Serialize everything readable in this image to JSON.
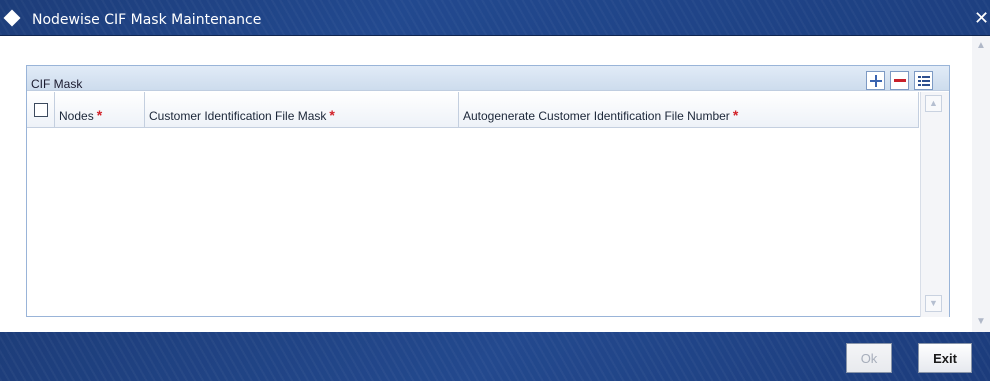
{
  "window": {
    "title": "Nodewise CIF Mask Maintenance",
    "close_glyph": "✕"
  },
  "panel": {
    "title": "CIF Mask",
    "toolbar": {
      "add_icon": "plus-icon",
      "delete_icon": "minus-icon",
      "select_icon": "list-icon"
    }
  },
  "grid": {
    "columns": [
      {
        "label": "Nodes",
        "required": true
      },
      {
        "label": "Customer Identification File Mask",
        "required": true
      },
      {
        "label": "Autogenerate Customer Identification File Number",
        "required": true
      }
    ],
    "required_marker": "*",
    "rows": []
  },
  "footer": {
    "ok_label": "Ok",
    "exit_label": "Exit"
  },
  "colors": {
    "titlebar": "#1d3d7a",
    "panel_header": "#d6e3f2",
    "required": "#d2232a"
  }
}
